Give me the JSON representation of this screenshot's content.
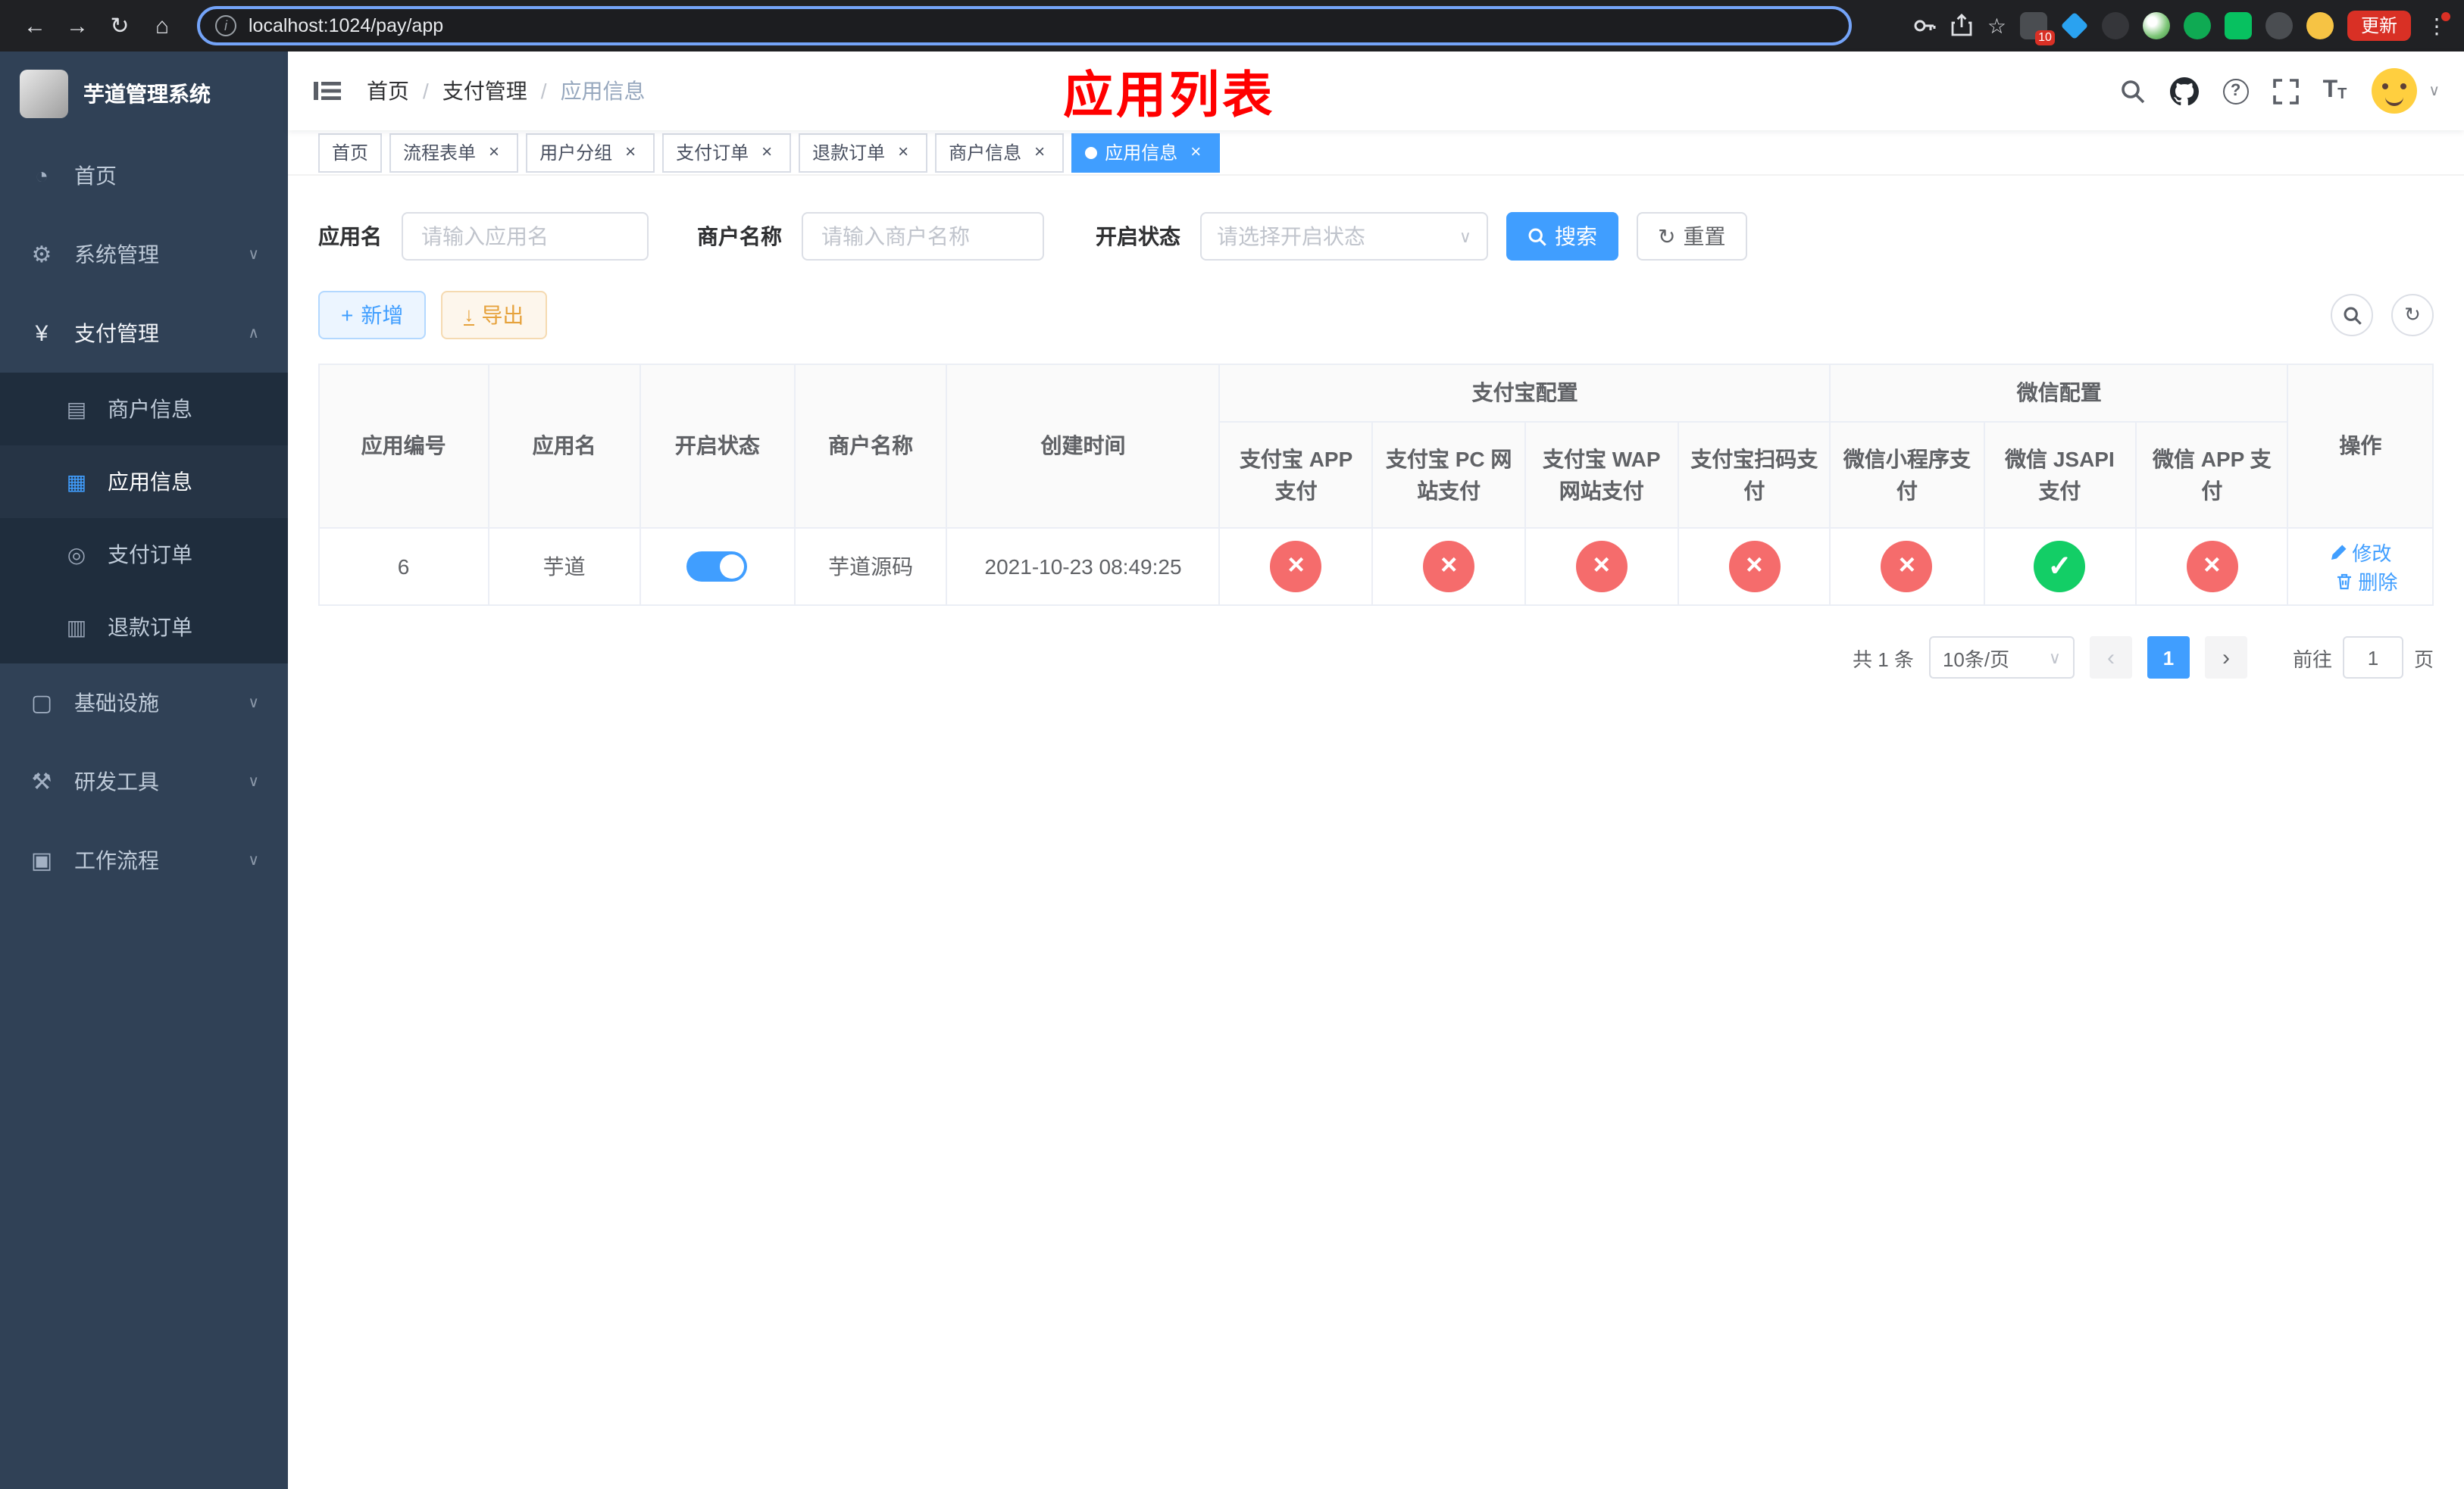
{
  "browser": {
    "url": "localhost:1024/pay/app",
    "update_label": "更新",
    "ext_badge": "10"
  },
  "icons": {
    "back": "←",
    "forward": "→",
    "reload": "↻",
    "home": "⌂",
    "info": "i",
    "star": "☆",
    "kebab": "⋮",
    "close": "×",
    "caret": "∨",
    "chevron_down": "∨",
    "chevron_up": "∧",
    "plus": "+",
    "download": "↓",
    "refresh": "↻",
    "question": "?",
    "font_t": "T",
    "prev": "‹",
    "next": "›",
    "dashboard": "◔",
    "gear": "⚙",
    "yen": "¥",
    "card": "▤",
    "grid": "▦",
    "target": "◎",
    "doc": "▥",
    "monitor": "▢",
    "tools": "⚒",
    "workflow": "▣"
  },
  "sidebar": {
    "title": "芋道管理系统",
    "items": {
      "home": "首页",
      "system": "系统管理",
      "payment": "支付管理",
      "infra": "基础设施",
      "devtools": "研发工具",
      "workflow": "工作流程"
    },
    "submenu": {
      "merchant": "商户信息",
      "app": "应用信息",
      "order": "支付订单",
      "refund": "退款订单"
    }
  },
  "header": {
    "breadcrumb": [
      "首页",
      "支付管理",
      "应用信息"
    ],
    "separator": "/",
    "title": "应用列表"
  },
  "tabs": [
    {
      "label": "首页"
    },
    {
      "label": "流程表单"
    },
    {
      "label": "用户分组"
    },
    {
      "label": "支付订单"
    },
    {
      "label": "退款订单"
    },
    {
      "label": "商户信息"
    },
    {
      "label": "应用信息"
    }
  ],
  "filters": {
    "app_name_label": "应用名",
    "app_name_placeholder": "请输入应用名",
    "merchant_label": "商户名称",
    "merchant_placeholder": "请输入商户名称",
    "status_label": "开启状态",
    "status_placeholder": "请选择开启状态",
    "search": "搜索",
    "reset": "重置"
  },
  "toolbar": {
    "add": "新增",
    "export": "导出"
  },
  "table": {
    "group_alipay": "支付宝配置",
    "group_wechat": "微信配置",
    "col_id": "应用编号",
    "col_name": "应用名",
    "col_status": "开启状态",
    "col_merchant": "商户名称",
    "col_created": "创建时间",
    "col_alipay_app": "支付宝 APP 支付",
    "col_alipay_pc": "支付宝 PC 网站支付",
    "col_alipay_wap": "支付宝 WAP 网站支付",
    "col_alipay_qr": "支付宝扫码支付",
    "col_wx_mini": "微信小程序支付",
    "col_wx_jsapi": "微信 JSAPI 支付",
    "col_wx_app": "微信 APP 支付",
    "col_actions": "操作",
    "row": {
      "id": "6",
      "name": "芋道",
      "enabled": "true",
      "merchant": "芋道源码",
      "created": "2021-10-23 08:49:25",
      "alipay": [
        "fail",
        "fail",
        "fail",
        "fail"
      ],
      "wechat": [
        "fail",
        "success",
        "fail"
      ],
      "edit": "修改",
      "delete": "删除"
    }
  },
  "pagination": {
    "total": "共 1 条",
    "page_size": "10条/页",
    "page": "1",
    "goto": "前往",
    "goto_value": "1",
    "unit": "页"
  }
}
